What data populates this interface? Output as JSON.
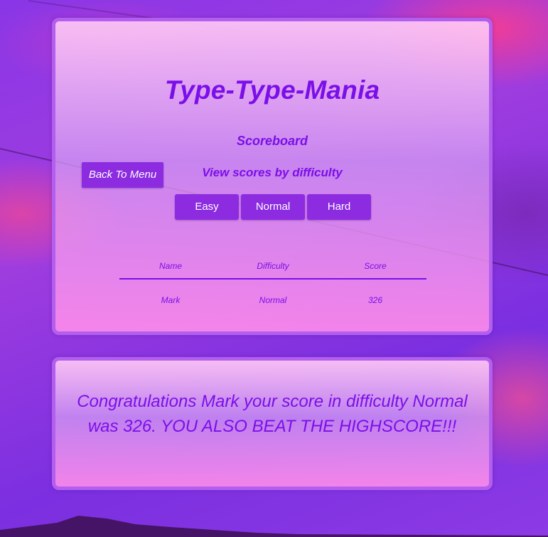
{
  "app": {
    "title": "Type-Type-Mania",
    "subtitle": "Scoreboard",
    "view_by_label": "View scores by difficulty"
  },
  "navigation": {
    "back_label": "Back To Menu"
  },
  "difficulty_buttons": [
    {
      "label": "Easy"
    },
    {
      "label": "Normal"
    },
    {
      "label": "Hard"
    }
  ],
  "scoreboard": {
    "columns": [
      "Name",
      "Difficulty",
      "Score"
    ],
    "rows": [
      {
        "name": "Mark",
        "difficulty": "Normal",
        "score": "326"
      }
    ]
  },
  "result": {
    "message": "Congratulations Mark your score in difficulty Normal was 326. YOU ALSO BEAT THE HIGHSCORE!!!"
  },
  "colors": {
    "accent": "#7a0fe8",
    "button": "#8c2be0",
    "panel_border": "#b25ff0"
  }
}
